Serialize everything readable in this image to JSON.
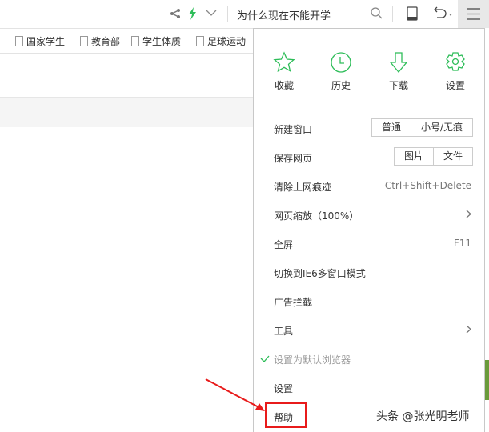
{
  "toolbar": {
    "search_text": "为什么现在不能开学"
  },
  "bookmarks": [
    "国家学生",
    "教育部",
    "学生体质",
    "足球运动"
  ],
  "menu": {
    "top": [
      {
        "label": "收藏",
        "icon": "star-icon"
      },
      {
        "label": "历史",
        "icon": "clock-icon"
      },
      {
        "label": "下载",
        "icon": "download-icon"
      },
      {
        "label": "设置",
        "icon": "gear-icon"
      }
    ],
    "new_window": "新建窗口",
    "new_window_opts": [
      "普通",
      "小号/无痕"
    ],
    "save_page": "保存网页",
    "save_opts": [
      "图片",
      "文件"
    ],
    "clear": "清除上网痕迹",
    "clear_shortcut": "Ctrl+Shift+Delete",
    "zoom": "网页缩放（100%）",
    "fullscreen": "全屏",
    "fullscreen_shortcut": "F11",
    "ie6": "切换到IE6多窗口模式",
    "adblock": "广告拦截",
    "tools": "工具",
    "default_browser": "设置为默认浏览器",
    "settings": "设置",
    "help": "帮助"
  },
  "watermark": "头条 @张光明老师",
  "colors": {
    "accent": "#2ebd59",
    "highlight": "#e81b1b"
  }
}
